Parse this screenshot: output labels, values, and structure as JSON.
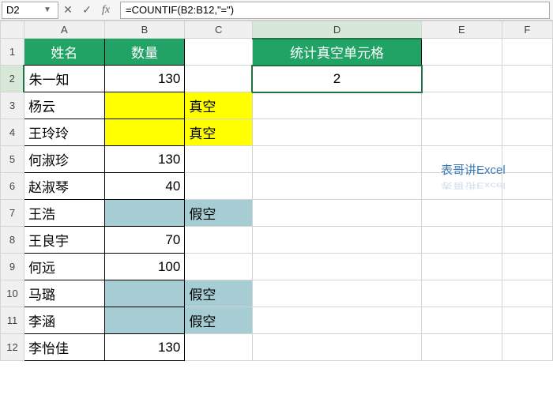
{
  "formula_bar": {
    "cell_ref": "D2",
    "dropdown_glyph": "▼",
    "cancel_glyph": "✕",
    "confirm_glyph": "✓",
    "fx_label": "fx",
    "formula": "=COUNTIF(B2:B12,\"=\")"
  },
  "column_headers": [
    "A",
    "B",
    "C",
    "D",
    "E",
    "F"
  ],
  "row_headers": [
    "1",
    "2",
    "3",
    "4",
    "5",
    "6",
    "7",
    "8",
    "9",
    "10",
    "11",
    "12"
  ],
  "headers": {
    "name": "姓名",
    "qty": "数量",
    "stat": "统计真空单元格"
  },
  "result": "2",
  "rows": [
    {
      "name": "朱一知",
      "qty": "130",
      "annot": ""
    },
    {
      "name": "杨云",
      "qty": "",
      "annot": "真空",
      "fill": "yellow"
    },
    {
      "name": "王玲玲",
      "qty": "",
      "annot": "真空",
      "fill": "yellow"
    },
    {
      "name": "何淑珍",
      "qty": "130",
      "annot": ""
    },
    {
      "name": "赵淑琴",
      "qty": "40",
      "annot": ""
    },
    {
      "name": "王浩",
      "qty": "",
      "annot": "假空",
      "fill": "teal"
    },
    {
      "name": "王良宇",
      "qty": "70",
      "annot": ""
    },
    {
      "name": "何远",
      "qty": "100",
      "annot": ""
    },
    {
      "name": "马璐",
      "qty": "",
      "annot": "假空",
      "fill": "teal"
    },
    {
      "name": "李涵",
      "qty": "",
      "annot": "假空",
      "fill": "teal"
    },
    {
      "name": "李怡佳",
      "qty": "130",
      "annot": ""
    }
  ],
  "watermark": "表哥讲Excel",
  "chart_data": {
    "type": "table",
    "title": "统计真空单元格",
    "columns": [
      "姓名",
      "数量"
    ],
    "data": [
      [
        "朱一知",
        130
      ],
      [
        "杨云",
        null
      ],
      [
        "王玲玲",
        null
      ],
      [
        "何淑珍",
        130
      ],
      [
        "赵淑琴",
        40
      ],
      [
        "王浩",
        ""
      ],
      [
        "王良宇",
        70
      ],
      [
        "何远",
        100
      ],
      [
        "马璐",
        ""
      ],
      [
        "李涵",
        ""
      ],
      [
        "李怡佳",
        130
      ]
    ],
    "formula": "=COUNTIF(B2:B12,\"=\")",
    "result": 2,
    "annotations": {
      "真空": "truly empty",
      "假空": "pseudo empty"
    }
  }
}
